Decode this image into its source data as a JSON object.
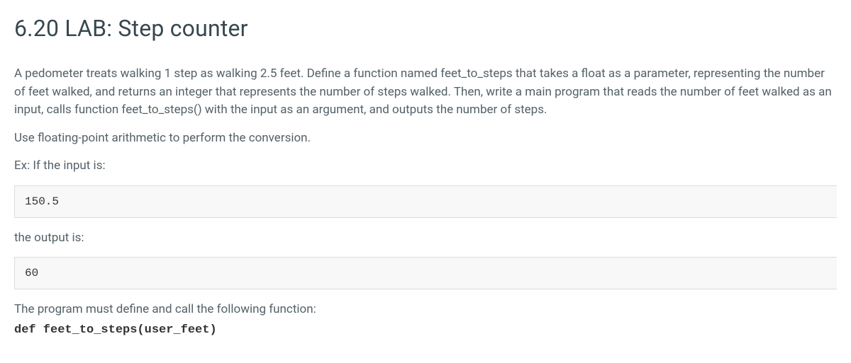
{
  "title": "6.20 LAB: Step counter",
  "para1": "A pedometer treats walking 1 step as walking 2.5 feet. Define a function named feet_to_steps that takes a float as a parameter, representing the number of feet walked, and returns an integer that represents the number of steps walked. Then, write a main program that reads the number of feet walked as an input, calls function feet_to_steps() with the input as an argument, and outputs the number of steps.",
  "para2": "Use floating-point arithmetic to perform the conversion.",
  "para3": "Ex: If the input is:",
  "code_input": "150.5",
  "para4": "the output is:",
  "code_output": "60",
  "para5": "The program must define and call the following function:",
  "code_signature": "def feet_to_steps(user_feet)"
}
